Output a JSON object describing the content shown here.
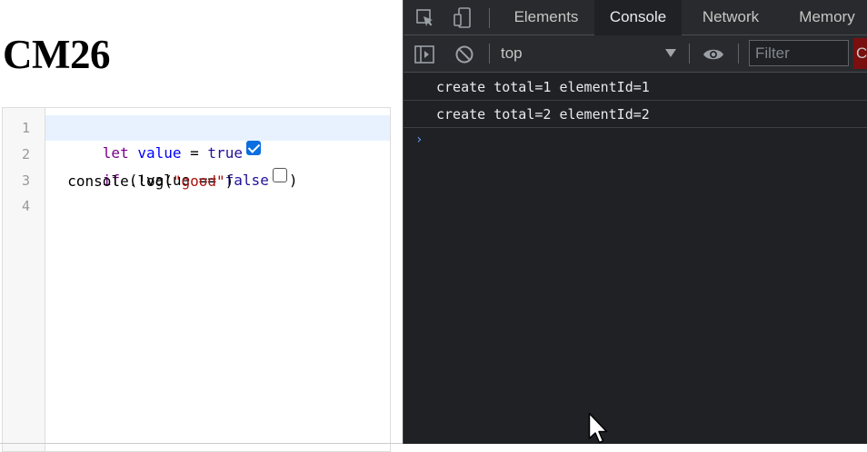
{
  "page": {
    "title": "CM26"
  },
  "editor": {
    "line_numbers": [
      "1",
      "2",
      "3",
      "4"
    ],
    "lines": [
      {
        "tokens": [
          {
            "cls": "kw",
            "text": "let"
          },
          {
            "cls": "",
            "text": " "
          },
          {
            "cls": "def",
            "text": "value"
          },
          {
            "cls": "",
            "text": " = "
          },
          {
            "cls": "atom",
            "text": "true"
          }
        ],
        "checkbox": "checked"
      },
      {
        "tokens": [
          {
            "cls": "kw",
            "text": "if"
          },
          {
            "cls": "",
            "text": " (!value == "
          },
          {
            "cls": "atom",
            "text": "false"
          }
        ],
        "checkbox": "unchecked",
        "after": ")"
      },
      {
        "tokens": [
          {
            "cls": "",
            "text": "  console.log("
          },
          {
            "cls": "str",
            "text": "\"good\""
          },
          {
            "cls": "",
            "text": ")"
          }
        ]
      },
      {
        "tokens": []
      }
    ],
    "line_texts": [
      "let value = true",
      "if (!value == false )",
      "  console.log(\"good\")",
      ""
    ]
  },
  "devtools": {
    "tabs": [
      "Elements",
      "Console",
      "Network",
      "Memory"
    ],
    "active_tab": "Console",
    "context": "top",
    "filter_placeholder": "Filter",
    "levels_label": "C",
    "messages": [
      "create total=1 elementId=1",
      "create total=2 elementId=2"
    ],
    "prompt_symbol": "›"
  },
  "colors": {
    "devtools_bg": "#202124",
    "toolbar_bg": "#292a2d",
    "keyword": "#770088",
    "variable": "#0000ff",
    "atom": "#221199",
    "string": "#aa1111",
    "checkbox_accent": "#0b6ee0"
  },
  "icons": [
    "inspect-element-icon",
    "device-toolbar-icon",
    "sidebar-toggle-icon",
    "clear-console-icon",
    "dropdown-arrow-icon",
    "live-expression-eye-icon",
    "mouse-cursor-icon"
  ]
}
